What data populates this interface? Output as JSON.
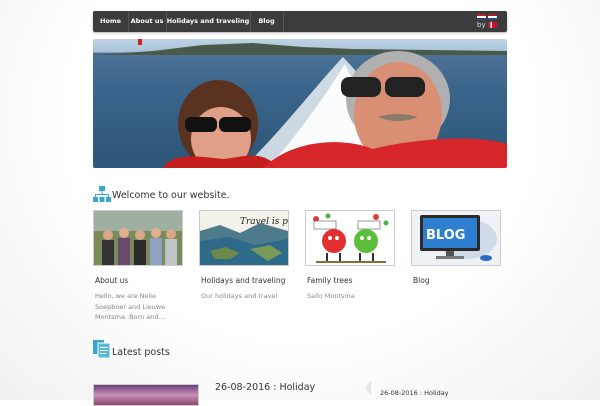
{
  "nav": {
    "items": [
      {
        "label": "Home"
      },
      {
        "label": "About us"
      },
      {
        "label": "Holidays and traveling"
      },
      {
        "label": "Blog"
      }
    ],
    "language": {
      "by_label": "by"
    }
  },
  "welcome": {
    "title": "Welcome to our website.",
    "cards": [
      {
        "title": "About us",
        "description": "Hello, we are Nelie Soepboer and Lieuwe Montsma. Born and...",
        "image_alt": "family-photo"
      },
      {
        "title": "Holidays and traveling",
        "description": "Our holidays and travel",
        "image_alt": "travel-is-priceless"
      },
      {
        "title": "Family trees",
        "description": "Sailo Montsma",
        "image_alt": "cartoon-apples"
      },
      {
        "title": "Blog",
        "description": "",
        "image_alt": "blog-monitor"
      }
    ],
    "travel_caption": "Travel is priceless.",
    "blog_caption": "BLOG"
  },
  "latest": {
    "title": "Latest posts",
    "post_title": "26-08-2016 : Holiday",
    "side_post": "26-08-2016 : Holiday"
  }
}
